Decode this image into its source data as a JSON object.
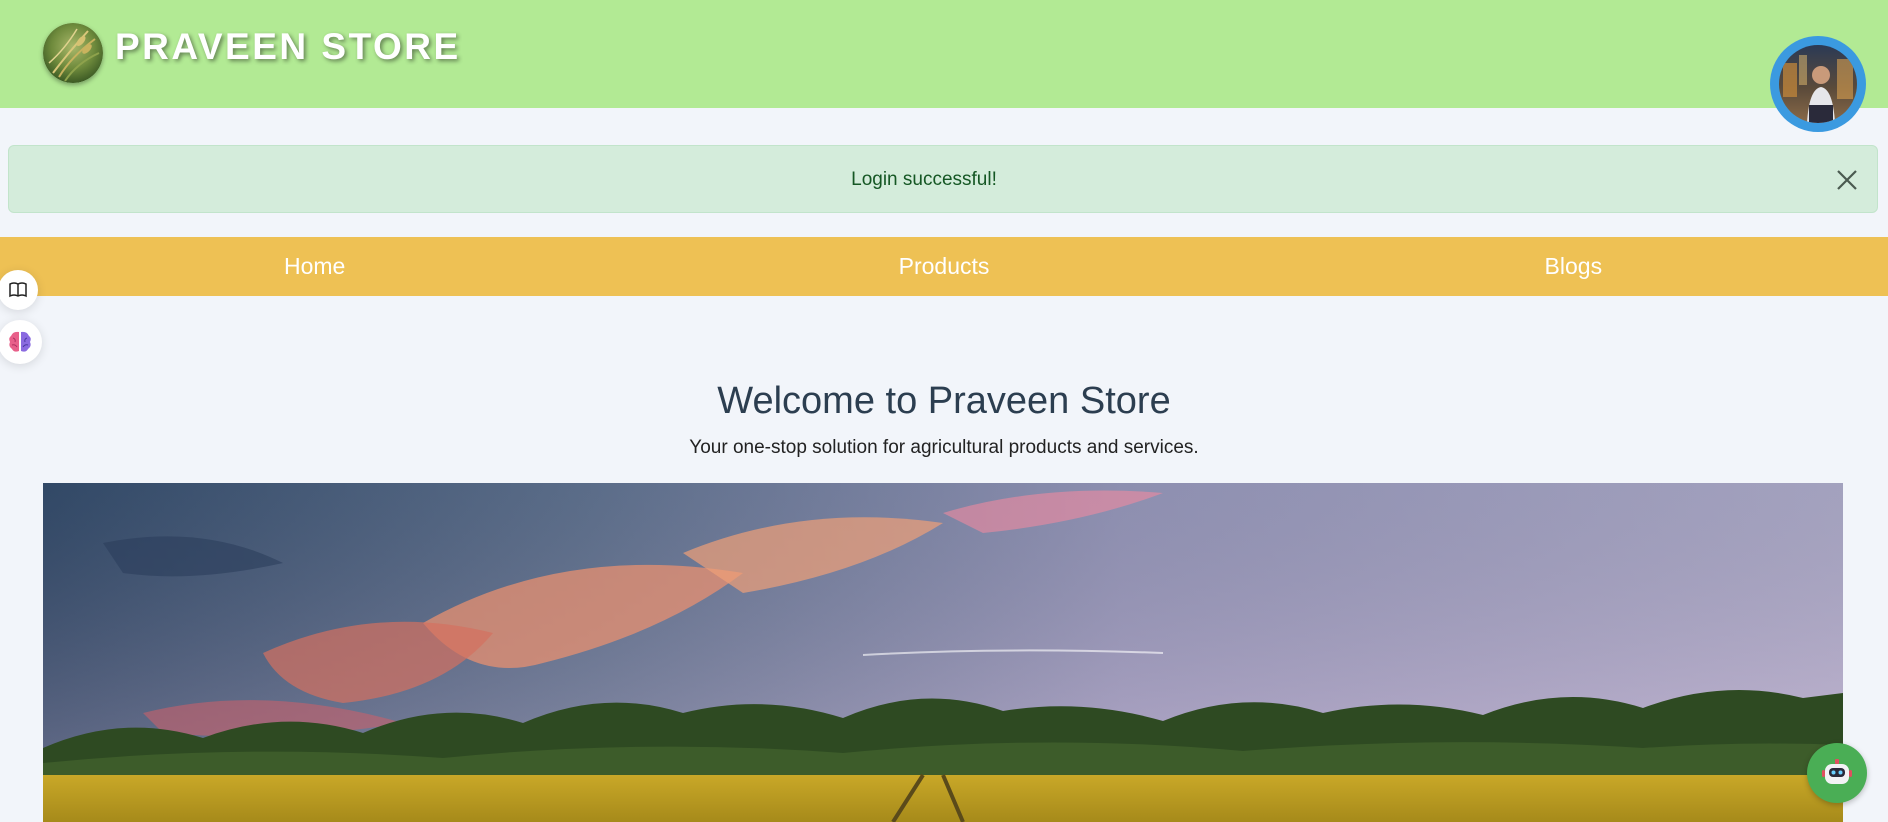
{
  "header": {
    "store_name": "PRAVEEN STORE",
    "logo_icon": "wheat-logo",
    "avatar_icon": "user-avatar"
  },
  "alert": {
    "message": "Login successful!",
    "close_icon": "close-icon"
  },
  "nav": {
    "items": [
      {
        "label": "Home"
      },
      {
        "label": "Products"
      },
      {
        "label": "Blogs"
      }
    ]
  },
  "side_tools": {
    "icons": [
      "book-icon",
      "brain-icon"
    ]
  },
  "hero": {
    "title": "Welcome to Praveen Store",
    "subtitle": "Your one-stop solution for agricultural products and services."
  },
  "chatbot": {
    "icon": "robot-icon"
  },
  "colors": {
    "header_bg": "#b2ea94",
    "alert_bg": "#d4ecdb",
    "alert_text": "#155724",
    "nav_bg": "#eec154",
    "avatar_ring": "#3b9ae0",
    "chatbot_bg": "#4aae55",
    "page_bg": "#f2f5fa"
  }
}
